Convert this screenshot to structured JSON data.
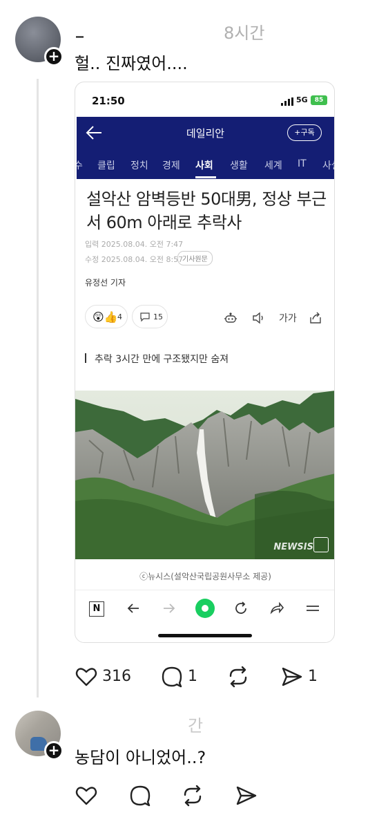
{
  "post1": {
    "username": "_",
    "time": "8시간",
    "text": "헐.. 진짜였어....",
    "likes": "316",
    "comments": "1",
    "shares": "1"
  },
  "phone": {
    "clock": "21:50",
    "network": "5G",
    "battery": "85",
    "app_title": "데일리안",
    "subscribe_label": "+구독",
    "categories": [
      "수",
      "클립",
      "정치",
      "경제",
      "사회",
      "생활",
      "세계",
      "IT",
      "사설"
    ],
    "active_category": "사회",
    "headline": "설악산 암벽등반 50대男, 정상 부근서 60m 아래로 추락사",
    "input_date": "입력 2025.08.04. 오전 7:47",
    "modified_date": "수정 2025.08.04. 오전 8:57",
    "original_button": "기사원문",
    "reporter": "유정선 기자",
    "reaction_count": "4",
    "comment_count": "15",
    "font_size_label": "가가",
    "subheadline": "추락 3시간 만에 구조됐지만 숨져",
    "photo_watermark": "NEWSIS",
    "photo_caption": "ⓒ뉴시스(설악산국립공원사무소 제공)",
    "browser_logo": "N"
  },
  "post2": {
    "username": "",
    "time": "간",
    "text": "농담이 아니었어..?"
  }
}
